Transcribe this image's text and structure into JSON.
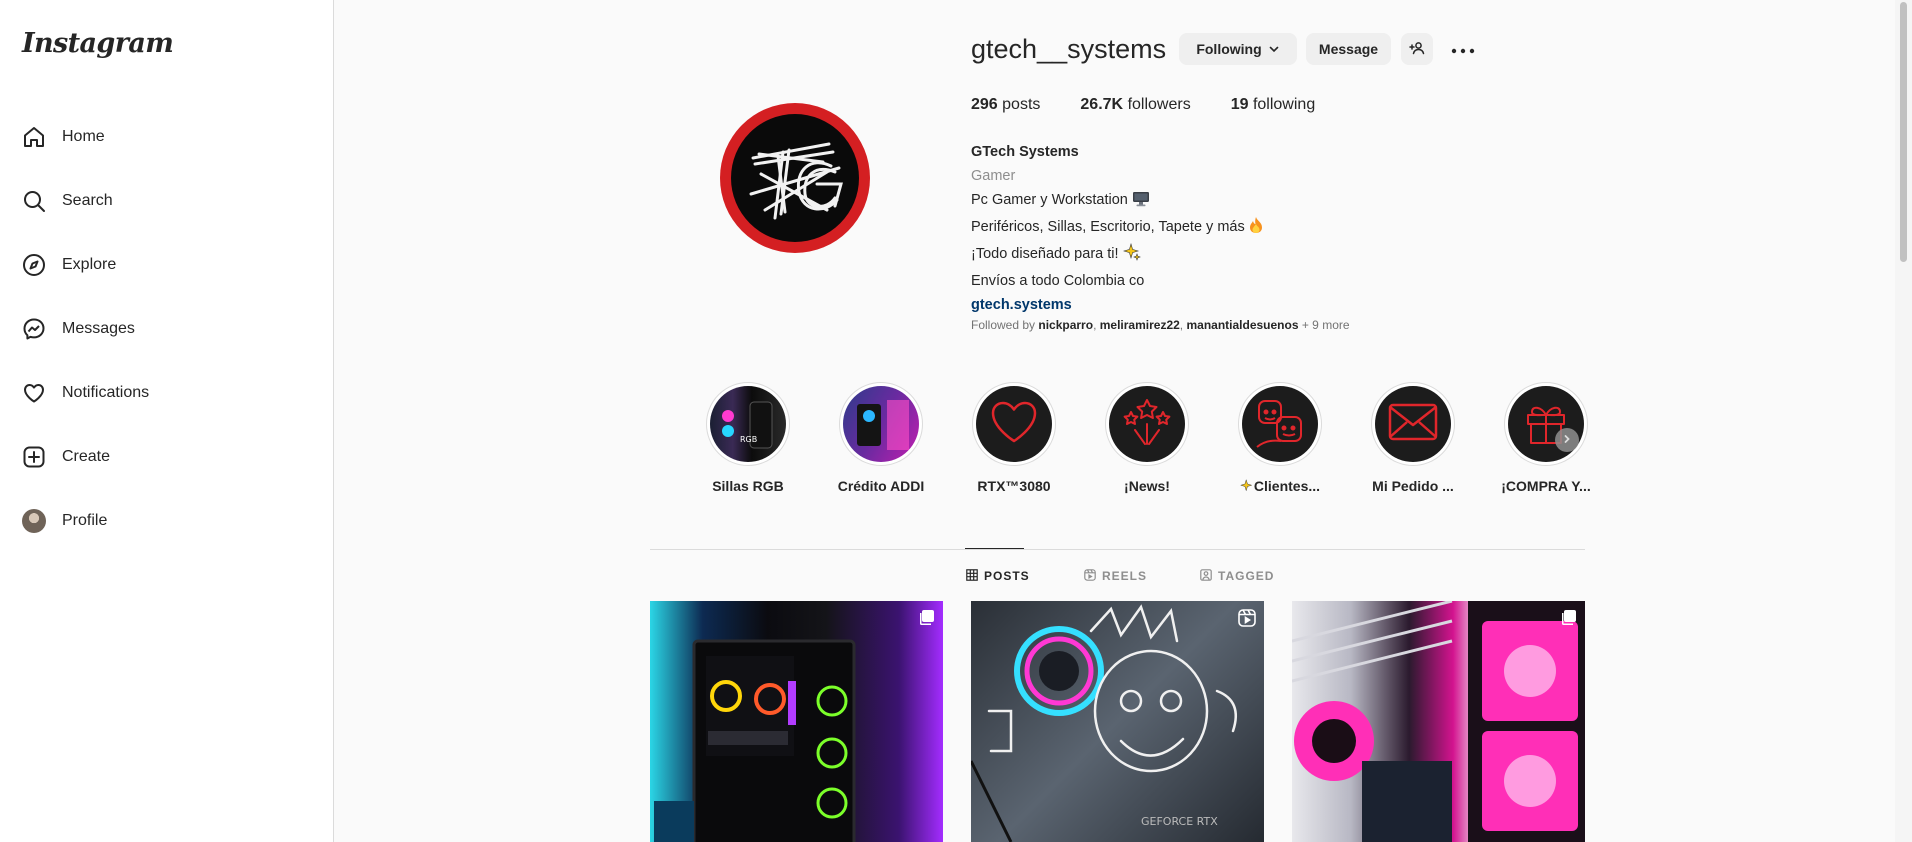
{
  "sidebar": {
    "logo": "Instagram",
    "items": [
      {
        "label": "Home",
        "icon": "home-icon"
      },
      {
        "label": "Search",
        "icon": "search-icon"
      },
      {
        "label": "Explore",
        "icon": "compass-icon"
      },
      {
        "label": "Messages",
        "icon": "messenger-icon"
      },
      {
        "label": "Notifications",
        "icon": "heart-icon"
      },
      {
        "label": "Create",
        "icon": "plus-square-icon"
      },
      {
        "label": "Profile",
        "icon": "avatar"
      }
    ]
  },
  "profile": {
    "username": "gtech__systems",
    "following_button": "Following",
    "message_button": "Message",
    "stats": {
      "posts_count": "296",
      "posts_label": "posts",
      "followers_count": "26.7K",
      "followers_label": "followers",
      "following_count": "19",
      "following_label": "following"
    },
    "bio": {
      "name": "GTech Systems",
      "category": "Gamer",
      "line1": "Pc Gamer y Workstation",
      "line2": "Periféricos, Sillas, Escritorio, Tapete y más",
      "line3": "¡Todo diseñado para ti!",
      "line4": "Envíos a todo Colombia co",
      "link": "gtech.systems"
    },
    "followed_by": {
      "prefix": "Followed by",
      "user1": "nickparro",
      "user2": "meliramirez22",
      "user3": "manantialdesuenos",
      "more": "+ 9 more"
    }
  },
  "highlights": [
    {
      "label": "Sillas RGB"
    },
    {
      "label": "Crédito ADDI"
    },
    {
      "label": "RTX™3080"
    },
    {
      "label": "¡News!"
    },
    {
      "label": "Clientes..."
    },
    {
      "label": "Mi Pedido ..."
    },
    {
      "label": "¡COMPRA Y..."
    }
  ],
  "tabs": {
    "posts": "POSTS",
    "reels": "REELS",
    "tagged": "TAGGED"
  },
  "colors": {
    "accent_red": "#e0262b",
    "link": "#00376b",
    "secondary_text": "#8e8e8e"
  }
}
